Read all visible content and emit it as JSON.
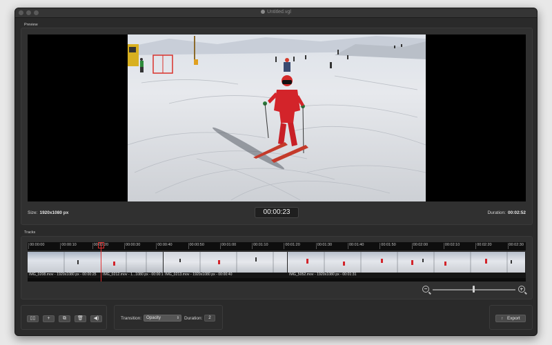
{
  "window": {
    "title": "Untitled.vgl"
  },
  "preview": {
    "section_label": "Preview",
    "size_label": "Size:",
    "size_value": "1920x1080 px",
    "timecode": "00:00:23",
    "duration_label": "Duration:",
    "duration_value": "00:02:52"
  },
  "tracks": {
    "section_label": "Tracks",
    "ruler_ticks": [
      "00:00:00",
      "00:00:10",
      "00:00:20",
      "00:00:30",
      "00:00:40",
      "00:00:50",
      "00:01:00",
      "00:01:10",
      "00:01:20",
      "00:01:30",
      "00:01:40",
      "00:01:50",
      "00:02:00",
      "00:02:10",
      "00:02:20",
      "00:02:30"
    ],
    "clips": [
      {
        "label": "IMG_0208.mov - 1920x1080 px - 00:00:25"
      },
      {
        "label": "IMG_0212.mov - 1...1080 px - 00:00:15"
      },
      {
        "label": "IMG_0213.mov - 1920x1080 px - 00:00:40"
      },
      {
        "label": "IMG_5052.mov - 1920x1080 px - 00:01:31"
      }
    ]
  },
  "toolbar": {
    "buttons": [
      {
        "icon": "book-icon",
        "glyph": "▯▯"
      },
      {
        "icon": "plus-icon",
        "glyph": "+"
      },
      {
        "icon": "duplicate-icon",
        "glyph": "⧉"
      },
      {
        "icon": "trash-icon",
        "glyph": "🗑"
      },
      {
        "icon": "speaker-icon",
        "glyph": "◀)"
      }
    ],
    "transition_label": "Transition:",
    "transition_value": "Opacity",
    "duration_label": "Duration:",
    "duration_value": "2",
    "export_label": "Export",
    "export_glyph": "↑"
  },
  "colors": {
    "accent": "#e03030",
    "window_bg": "#2a2a2a"
  }
}
